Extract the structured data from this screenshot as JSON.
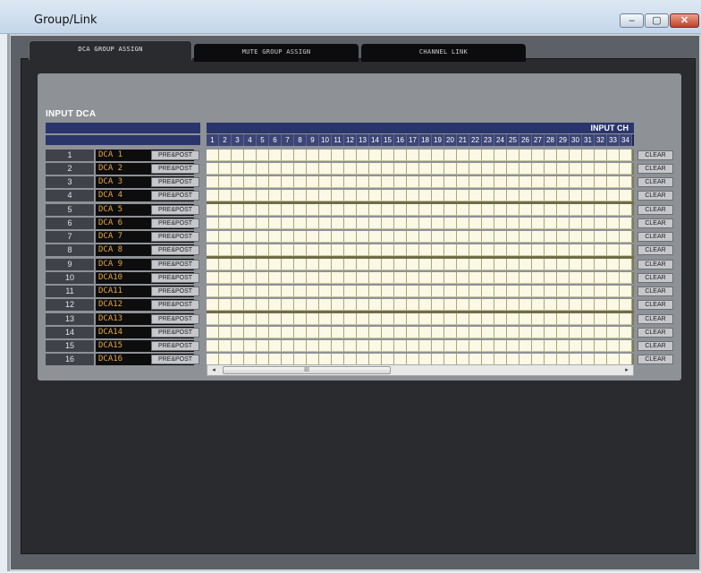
{
  "window": {
    "title": "Group/Link"
  },
  "controls": {
    "minimize": "–",
    "maximize": "▢",
    "close": "✕"
  },
  "tabs": [
    {
      "label": "DCA GROUP ASSIGN",
      "active": true
    },
    {
      "label": "MUTE GROUP ASSIGN",
      "active": false
    },
    {
      "label": "CHANNEL LINK",
      "active": false
    }
  ],
  "section": {
    "title": "INPUT DCA"
  },
  "grid_header": {
    "label": "INPUT CH"
  },
  "channels": [
    "1",
    "2",
    "3",
    "4",
    "5",
    "6",
    "7",
    "8",
    "9",
    "10",
    "11",
    "12",
    "13",
    "14",
    "15",
    "16",
    "17",
    "18",
    "19",
    "20",
    "21",
    "22",
    "23",
    "24",
    "25",
    "26",
    "27",
    "28",
    "29",
    "30",
    "31",
    "32",
    "33",
    "34"
  ],
  "rows": [
    {
      "number": "1",
      "name": "DCA 1",
      "prepost": "PRE&POST",
      "clear": "CLEAR"
    },
    {
      "number": "2",
      "name": "DCA 2",
      "prepost": "PRE&POST",
      "clear": "CLEAR"
    },
    {
      "number": "3",
      "name": "DCA 3",
      "prepost": "PRE&POST",
      "clear": "CLEAR"
    },
    {
      "number": "4",
      "name": "DCA 4",
      "prepost": "PRE&POST",
      "clear": "CLEAR"
    },
    {
      "number": "5",
      "name": "DCA 5",
      "prepost": "PRE&POST",
      "clear": "CLEAR"
    },
    {
      "number": "6",
      "name": "DCA 6",
      "prepost": "PRE&POST",
      "clear": "CLEAR"
    },
    {
      "number": "7",
      "name": "DCA 7",
      "prepost": "PRE&POST",
      "clear": "CLEAR"
    },
    {
      "number": "8",
      "name": "DCA 8",
      "prepost": "PRE&POST",
      "clear": "CLEAR"
    },
    {
      "number": "9",
      "name": "DCA 9",
      "prepost": "PRE&POST",
      "clear": "CLEAR"
    },
    {
      "number": "10",
      "name": "DCA10",
      "prepost": "PRE&POST",
      "clear": "CLEAR"
    },
    {
      "number": "11",
      "name": "DCA11",
      "prepost": "PRE&POST",
      "clear": "CLEAR"
    },
    {
      "number": "12",
      "name": "DCA12",
      "prepost": "PRE&POST",
      "clear": "CLEAR"
    },
    {
      "number": "13",
      "name": "DCA13",
      "prepost": "PRE&POST",
      "clear": "CLEAR"
    },
    {
      "number": "14",
      "name": "DCA14",
      "prepost": "PRE&POST",
      "clear": "CLEAR"
    },
    {
      "number": "15",
      "name": "DCA15",
      "prepost": "PRE&POST",
      "clear": "CLEAR"
    },
    {
      "number": "16",
      "name": "DCA16",
      "prepost": "PRE&POST",
      "clear": "CLEAR"
    }
  ],
  "scrollbar": {
    "left_arrow": "◂",
    "right_arrow": "▸",
    "thumb_grip": "III"
  }
}
